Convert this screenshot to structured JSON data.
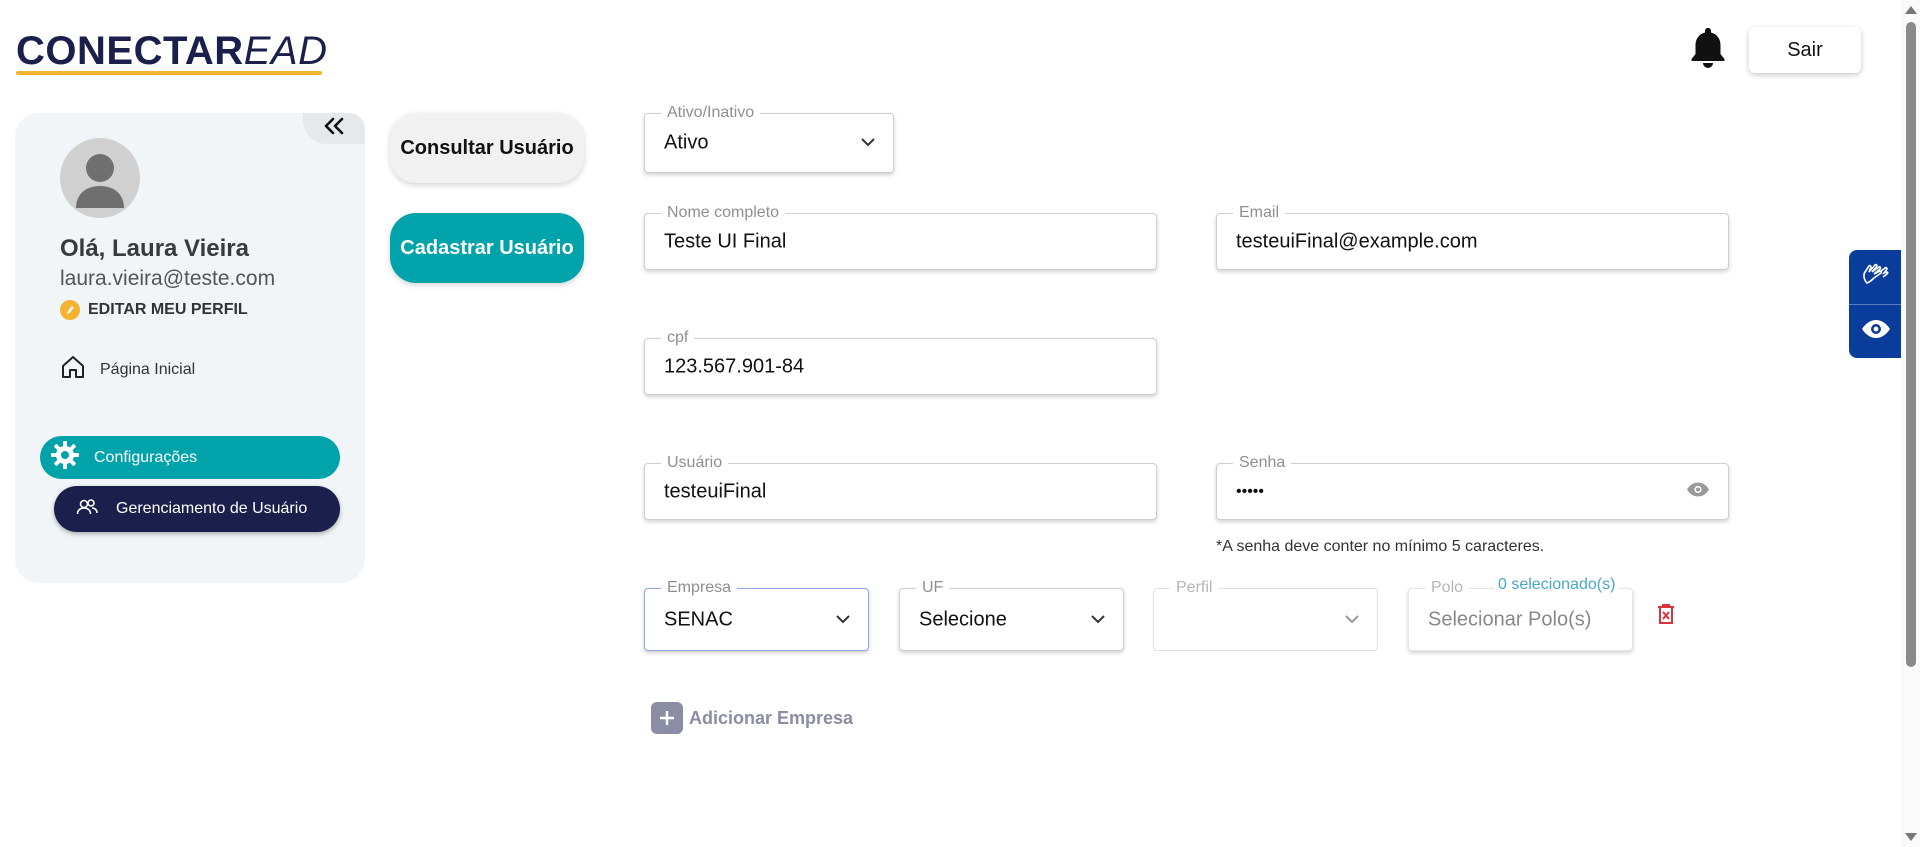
{
  "header": {
    "logo_bold": "CONECTAR",
    "logo_italic": "EAD",
    "logout_label": "Sair",
    "brand_colors": {
      "navy": "#1b1f4b",
      "yellow": "#f2b431",
      "teal": "#01a3ab"
    }
  },
  "sidebar": {
    "greeting": "Olá, Laura Vieira",
    "email": "laura.vieira@teste.com",
    "edit_profile": "EDITAR MEU PERFIL",
    "home": "Página Inicial",
    "settings": "Configurações",
    "user_management": "Gerenciamento de Usuário"
  },
  "actions": {
    "consult": "Consultar Usuário",
    "register": "Cadastrar Usuário"
  },
  "form": {
    "status": {
      "label": "Ativo/Inativo",
      "value": "Ativo"
    },
    "full_name": {
      "label": "Nome completo",
      "value": "Teste UI Final"
    },
    "email": {
      "label": "Email",
      "value": "testeuiFinal@example.com"
    },
    "cpf": {
      "label": "cpf",
      "value": "123.567.901-84"
    },
    "username": {
      "label": "Usuário",
      "value": "testeuiFinal"
    },
    "password": {
      "label": "Senha",
      "value": "•••••",
      "hint": "*A senha deve conter no mínimo 5 caracteres."
    },
    "company": {
      "label": "Empresa",
      "value": "SENAC"
    },
    "uf": {
      "label": "UF",
      "value": "Selecione"
    },
    "profile": {
      "label": "Perfil",
      "value": ""
    },
    "polo": {
      "label": "Polo",
      "placeholder": "Selecionar Polo(s)",
      "count": "0 selecionado(s)"
    },
    "add_company": "Adicionar Empresa"
  }
}
